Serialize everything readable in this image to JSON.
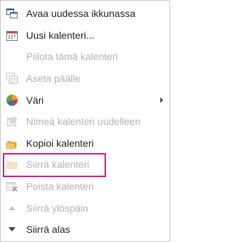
{
  "menu": {
    "items": [
      {
        "label": "Avaa uudessa ikkunassa",
        "icon": "new-window-icon",
        "enabled": true
      },
      {
        "label": "Uusi kalenteri...",
        "icon": "new-calendar-icon",
        "enabled": true
      },
      {
        "label": "Piilota tämä kalenteri",
        "icon": "",
        "enabled": false
      },
      {
        "label": "Aseta päälle",
        "icon": "overlay-icon",
        "enabled": false
      },
      {
        "label": "Väri",
        "icon": "color-icon",
        "enabled": true,
        "submenu": true
      },
      {
        "label": "Nimeä kalenteri uudelleen",
        "icon": "rename-icon",
        "enabled": false
      },
      {
        "label": "Kopioi kalenteri",
        "icon": "copy-folder-icon",
        "enabled": true
      },
      {
        "label": "Siirrä kalenteri",
        "icon": "move-folder-icon",
        "enabled": false
      },
      {
        "label": "Poista kalenteri",
        "icon": "delete-calendar-icon",
        "enabled": false
      },
      {
        "label": "Siirrä ylöspäin",
        "icon": "move-up-icon",
        "enabled": false
      },
      {
        "label": "Siirrä alas",
        "icon": "move-down-icon",
        "enabled": true
      }
    ]
  },
  "colors": {
    "highlight_border": "#d4148e",
    "disabled_text": "#b3b3b3"
  }
}
